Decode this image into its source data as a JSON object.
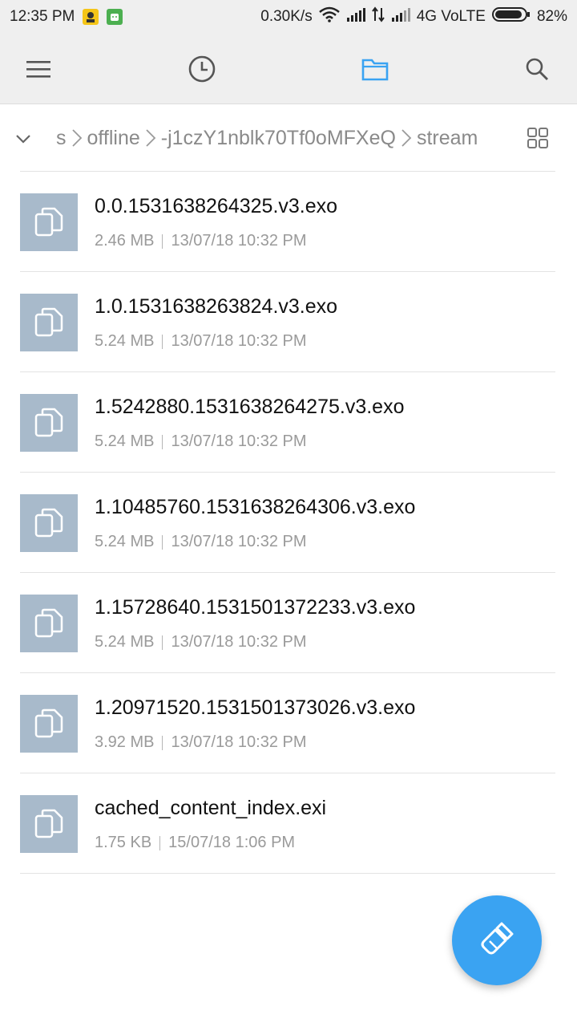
{
  "status_bar": {
    "time": "12:35 PM",
    "net_speed": "0.30K/s",
    "network": "4G VoLTE",
    "battery": "82%",
    "icons": [
      "notification-icon-yellow",
      "notification-icon-green",
      "wifi-icon",
      "signal-icon",
      "data-arrows-icon",
      "signal-icon-2",
      "battery-icon"
    ]
  },
  "toolbar": {
    "icons": [
      "menu-icon",
      "recent-clock-icon",
      "folder-icon",
      "search-icon"
    ],
    "active": "folder-icon",
    "accent": "#3aa3f2"
  },
  "breadcrumb": {
    "items": [
      "s",
      "offline",
      "-j1czY1nblk70Tf0oMFXeQ",
      "stream"
    ],
    "icons": [
      "collapse-chevron-icon",
      "grid-view-icon"
    ]
  },
  "files": [
    {
      "name": "0.0.1531638264325.v3.exo",
      "size": "2.46 MB",
      "date": "13/07/18 10:32 PM"
    },
    {
      "name": "1.0.1531638263824.v3.exo",
      "size": "5.24 MB",
      "date": "13/07/18 10:32 PM"
    },
    {
      "name": "1.5242880.1531638264275.v3.exo",
      "size": "5.24 MB",
      "date": "13/07/18 10:32 PM"
    },
    {
      "name": "1.10485760.1531638264306.v3.exo",
      "size": "5.24 MB",
      "date": "13/07/18 10:32 PM"
    },
    {
      "name": "1.15728640.1531501372233.v3.exo",
      "size": "5.24 MB",
      "date": "13/07/18 10:32 PM"
    },
    {
      "name": "1.20971520.1531501373026.v3.exo",
      "size": "3.92 MB",
      "date": "13/07/18 10:32 PM"
    },
    {
      "name": "cached_content_index.exi",
      "size": "1.75 KB",
      "date": "15/07/18 1:06 PM"
    }
  ],
  "fab": {
    "icon": "cleaner-brush-icon",
    "color": "#3aa3f2"
  }
}
